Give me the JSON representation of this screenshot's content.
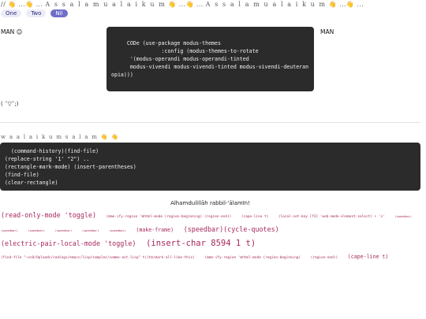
{
  "header": {
    "prefix": "// ",
    "parts": [
      {
        "t": "👋",
        "c": "e"
      },
      {
        "t": " ...",
        "c": ""
      },
      {
        "t": "👋",
        "c": "e"
      },
      {
        "t": " ... ",
        "c": ""
      },
      {
        "t": "A s s a l a m u a l a i k u m",
        "c": "lt"
      },
      {
        "t": " ",
        "c": ""
      },
      {
        "t": "👋",
        "c": "e"
      },
      {
        "t": " ...",
        "c": ""
      },
      {
        "t": "👋",
        "c": "e"
      },
      {
        "t": " ... ",
        "c": ""
      },
      {
        "t": "A s s a l a m u a l a i k u m",
        "c": "lt"
      },
      {
        "t": " ",
        "c": ""
      },
      {
        "t": "👋",
        "c": "e"
      },
      {
        "t": " ...",
        "c": ""
      },
      {
        "t": "👋",
        "c": "e"
      },
      {
        "t": " ...",
        "c": ""
      }
    ]
  },
  "tabs": [
    {
      "label": "One",
      "active": false
    },
    {
      "label": "Two",
      "active": false
    },
    {
      "label": "Nil",
      "active": true
    }
  ],
  "man_left": "MAN 😊",
  "man_right": "MAN",
  "code_modus": "     CODe (use-package modus-themes\n                :config (modus-themes-to-rotate\n      '(modus-operandi modus-operandi-tinted\n      modus-vivendi modus-vivendi-tinted modus-vivendi-deuteran\nopia)))",
  "kaomoji": "( ˘▽˘;)",
  "reply_line": "w a a l a i k u m s a l a m 👋 👋",
  "code_history": "  (command-history)(find-file)\n(replace-string '1' \"2\") ..\n(rectangle-mark-mode) (insert-parentheses)\n(find-file)\n(clear-rectangle)",
  "alhamdu": "Alhamdulillāh rabbil-'ālamīn!",
  "word_cloud": [
    {
      "t": "(read-only-mode 'toggle)",
      "s": "l"
    },
    {
      "t": "(mme-ify-region 'mhtml-mode (region-beginning) (region-end))",
      "s": "s"
    },
    {
      "t": "(cape-line t)",
      "s": "s"
    },
    {
      "t": "(local-set-key [f3] 'web-mode-element-select) + 's'",
      "s": "s"
    },
    {
      "t": "(speedbar)",
      "s": "xs"
    },
    {
      "t": "(speedbar)",
      "s": "xs"
    },
    {
      "t": "(speedbar)",
      "s": "xs"
    },
    {
      "t": "(speedbar)",
      "s": "xs"
    },
    {
      "t": "(speedbar)",
      "s": "xs"
    },
    {
      "t": "(speedbar)",
      "s": "xs"
    },
    {
      "t": "(make-frame)",
      "s": "m"
    },
    {
      "t": "(speedbar)(cycle-quotes)",
      "s": "l"
    },
    {
      "t": "(electric-pair-local-mode 'toggle)",
      "s": "l"
    },
    {
      "t": "(insert-char 8594 1 t)",
      "s": "xl"
    },
    {
      "t": "(find-file \"~ssU/Uploads/codings/emacs/lisp/samples/commo-ast.lisp\" t)(tm/mark-all-like-this)",
      "s": "s"
    },
    {
      "t": "(mme-ify-region 'mhtml-mode (region-beginning)",
      "s": "s"
    },
    {
      "t": "(region-end))",
      "s": "s"
    },
    {
      "t": "(cape-line t)",
      "s": "m"
    }
  ]
}
